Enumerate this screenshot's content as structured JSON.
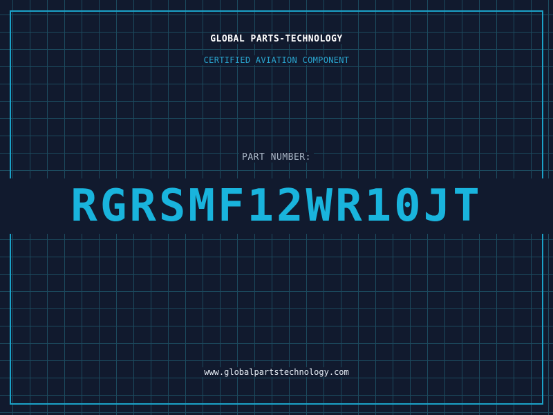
{
  "header": {
    "company": "GLOBAL PARTS-TECHNOLOGY",
    "subtitle": "CERTIFIED AVIATION COMPONENT"
  },
  "part": {
    "label": "PART NUMBER:",
    "number": "RGRSMF12WR10JT"
  },
  "footer": {
    "website": "www.globalpartstechnology.com"
  },
  "colors": {
    "background": "#111a2e",
    "grid": "#1c4a5e",
    "accent": "#19b4dd",
    "frame": "#1ba2c8"
  }
}
